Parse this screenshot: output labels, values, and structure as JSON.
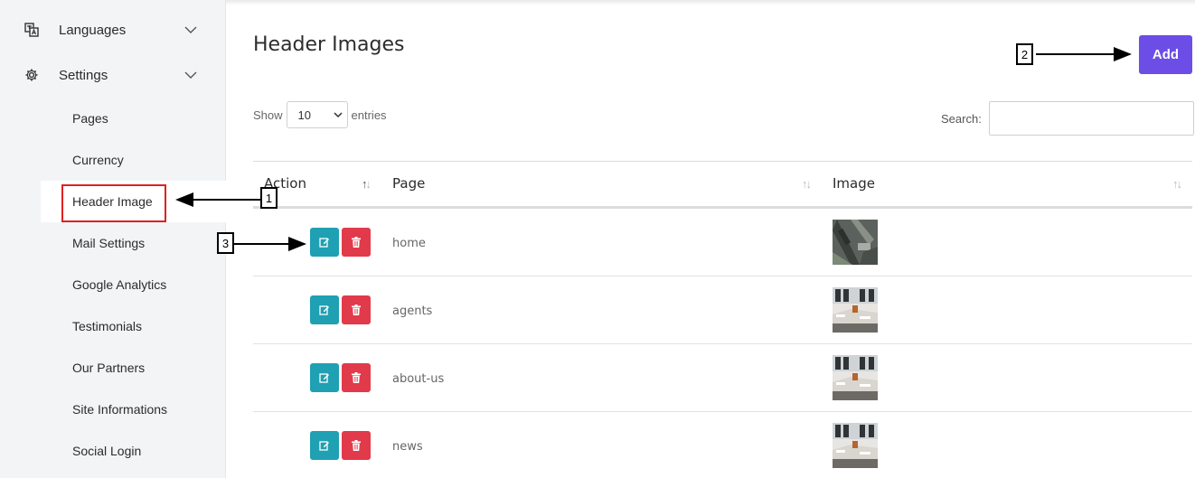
{
  "sidebar": {
    "languages": {
      "label": "Languages",
      "icon": "translate-icon"
    },
    "settings": {
      "label": "Settings",
      "icon": "gear-icon"
    },
    "submenu": [
      "Pages",
      "Currency",
      "Header Image",
      "Mail Settings",
      "Google Analytics",
      "Testimonials",
      "Our Partners",
      "Site Informations",
      "Social Login"
    ]
  },
  "main": {
    "title": "Header Images",
    "add_label": "Add",
    "show_label": "Show",
    "entries_value": "10",
    "entries_label": "entries",
    "search_label": "Search:",
    "search_value": ""
  },
  "table": {
    "columns": [
      "Action",
      "Page",
      "Image"
    ],
    "rows": [
      {
        "page": "home",
        "image": "aerial-city-thumbnail"
      },
      {
        "page": "agents",
        "image": "office-interior-thumbnail"
      },
      {
        "page": "about-us",
        "image": "office-interior-thumbnail"
      },
      {
        "page": "news",
        "image": "office-interior-thumbnail"
      }
    ]
  },
  "annotations": [
    "1",
    "2",
    "3"
  ],
  "colors": {
    "add_button": "#6c4de6",
    "edit_button": "#1fa0b3",
    "delete_button": "#e13a4a",
    "highlight_box": "#e02020"
  }
}
